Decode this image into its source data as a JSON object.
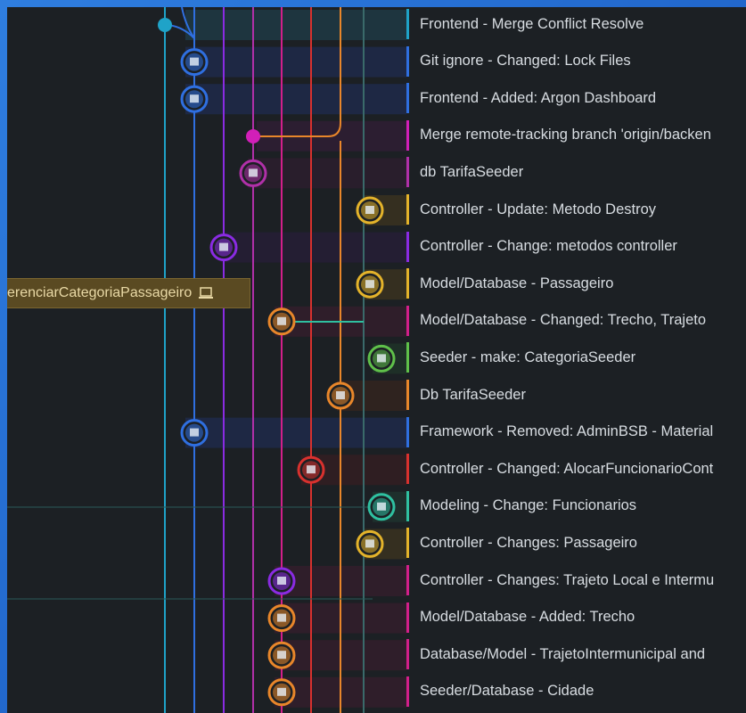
{
  "branch_label": {
    "text": "erenciarCategoriaPassageiro",
    "icon": "laptop-icon"
  },
  "commits": [
    {
      "message": "Frontend - Merge Conflict Resolve",
      "lane_color": "#1fa3c8"
    },
    {
      "message": "Git ignore - Changed: Lock Files",
      "lane_color": "#2f6fe0"
    },
    {
      "message": "Frontend - Added: Argon Dashboard",
      "lane_color": "#2f6fe0"
    },
    {
      "message": "Merge remote-tracking branch 'origin/backen",
      "lane_color": "#d21fb8"
    },
    {
      "message": "db TarifaSeeder",
      "lane_color": "#b030a8"
    },
    {
      "message": "Controller - Update: Metodo Destroy",
      "lane_color": "#e4b32a"
    },
    {
      "message": "Controller - Change: metodos controller",
      "lane_color": "#8a2be2"
    },
    {
      "message": "Model/Database - Passageiro",
      "lane_color": "#e4b32a"
    },
    {
      "message": "Model/Database - Changed: Trecho, Trajeto",
      "lane_color": "#d21f8a"
    },
    {
      "message": "Seeder - make: CategoriaSeeder",
      "lane_color": "#5fc04a"
    },
    {
      "message": "Db TarifaSeeder",
      "lane_color": "#e8862a"
    },
    {
      "message": "Framework - Removed: AdminBSB - Material",
      "lane_color": "#2f6fe0"
    },
    {
      "message": "Controller - Changed: AlocarFuncionarioCont",
      "lane_color": "#d8312e"
    },
    {
      "message": "Modeling - Change: Funcionarios",
      "lane_color": "#2fc0a0"
    },
    {
      "message": "Controller - Changes: Passageiro",
      "lane_color": "#e4b32a"
    },
    {
      "message": "Controller - Changes: Trajeto Local e Intermu",
      "lane_color": "#d21f8a"
    },
    {
      "message": "Model/Database - Added: Trecho",
      "lane_color": "#d21f8a"
    },
    {
      "message": "Database/Model - TrajetoIntermunicipal and",
      "lane_color": "#d21f8a"
    },
    {
      "message": "Seeder/Database - Cidade",
      "lane_color": "#d21f8a"
    }
  ]
}
